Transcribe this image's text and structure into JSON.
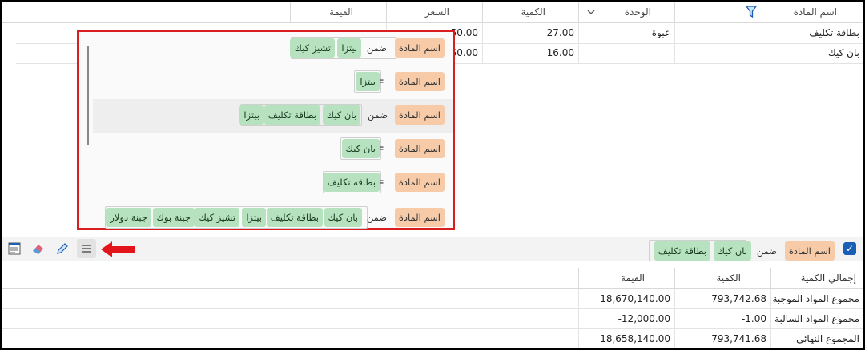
{
  "grid": {
    "headers": {
      "material_name": "اسم المادة",
      "unit": "الوحدة",
      "quantity": "الكمية",
      "price": "السعر",
      "value": "القيمة"
    },
    "rows": [
      {
        "material_name": "بطاقة تكليف",
        "unit": "عبوة",
        "quantity": "27.00",
        "price": "50.00"
      },
      {
        "material_name": "بان كيك",
        "unit": "",
        "quantity": "16.00",
        "price": "50.00"
      }
    ]
  },
  "filter_popup": {
    "rows": [
      {
        "field": "اسم المادة",
        "op": "ضمن",
        "values": [
          "بيتزا",
          "تشيز كيك"
        ]
      },
      {
        "field": "اسم المادة",
        "op": "=",
        "values": [
          "بيتزا"
        ]
      },
      {
        "field": "اسم المادة",
        "op": "ضمن",
        "values": [
          "بان كيك",
          "بطاقة تكليف",
          "بيتزا"
        ]
      },
      {
        "field": "اسم المادة",
        "op": "=",
        "values": [
          "بان كيك"
        ]
      },
      {
        "field": "اسم المادة",
        "op": "=",
        "values": [
          "بطاقة تكليف"
        ]
      },
      {
        "field": "اسم المادة",
        "op": "ضمن",
        "values": [
          "بان كيك",
          "بطاقة تكليف",
          "بيتزا",
          "تشيز كيك",
          "جبنة بوك",
          "جبنة دولار"
        ]
      }
    ]
  },
  "active_filter": {
    "enabled": true,
    "field": "اسم المادة",
    "op": "ضمن",
    "values": [
      "بان كيك",
      "بطاقة تكليف"
    ]
  },
  "toolbar": {
    "icons": [
      "filter-editor-icon",
      "eraser-icon",
      "pencil-icon",
      "menu-icon"
    ]
  },
  "summary": {
    "headers": {
      "label": "إجمالي الكمية",
      "quantity": "الكمية",
      "value": "القيمة"
    },
    "rows": [
      {
        "label": "مجموع المواد الموجبة",
        "quantity": "793,742.68",
        "value": "18,670,140.00"
      },
      {
        "label": "مجموع المواد السالبة",
        "quantity": "-1.00",
        "value": "-12,000.00"
      },
      {
        "label": "المجموع النهائي",
        "quantity": "793,741.68",
        "value": "18,658,140.00"
      }
    ]
  },
  "colors": {
    "highlight_border": "#d81e1e",
    "field_chip": "#f7cba8",
    "value_chip": "#b7e2c0",
    "checkbox": "#1a5fb4"
  }
}
